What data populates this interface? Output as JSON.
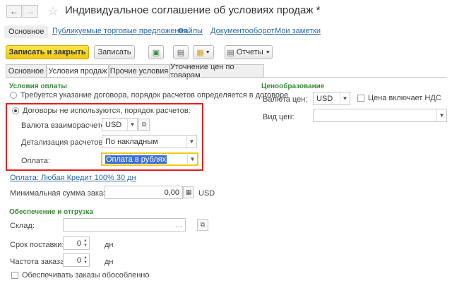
{
  "window": {
    "title": "Индивидуальное соглашение об условиях продаж *"
  },
  "nav": {
    "items": [
      "Основное",
      "Публикуемые торговые предложения",
      "Файлы",
      "Документооборот",
      "Мои заметки"
    ]
  },
  "toolbar": {
    "save_close_label": "Записать и закрыть",
    "save_label": "Записать",
    "reports_label": "Отчеты"
  },
  "tabs": [
    "Основное",
    "Условия продаж",
    "Прочие условия",
    "Уточнение цен по товарам"
  ],
  "payment_terms": {
    "section_title": "Условия оплаты",
    "option1_label": "Требуется указание договора, порядок расчетов определяется в договоре",
    "option2_label": "Договоры не используются, порядок расчетов:",
    "currency_label": "Валюта взаиморасчетов:",
    "currency_value": "USD",
    "detail_label": "Детализация расчетов:",
    "detail_value": "По накладным",
    "payment_label": "Оплата:",
    "payment_value": "Оплата в рублях",
    "payment_link": "Оплата: Любая Кредит 100% 30 дн",
    "min_order_label": "Минимальная сумма заказа:",
    "min_order_value": "0,00",
    "min_order_currency": "USD"
  },
  "pricing": {
    "section_title": "Ценообразование",
    "price_currency_label": "Валюта цен:",
    "price_currency_value": "USD",
    "vat_label": "Цена включает НДС",
    "price_type_label": "Вид цен:",
    "price_type_value": ""
  },
  "shipping": {
    "section_title": "Обеспечение и отгрузка",
    "warehouse_label": "Склад:",
    "warehouse_value": "",
    "delivery_label": "Срок поставки:",
    "delivery_value": "0",
    "delivery_unit": "дн",
    "frequency_label": "Частота заказа:",
    "frequency_value": "0",
    "frequency_unit": "дн",
    "separate_label": "Обеспечивать заказы обособленно"
  },
  "colors": {
    "accent_yellow": "#f5d320",
    "section_green": "#3a8a3a",
    "highlight_red": "#e02020",
    "link_blue": "#2c6aa6",
    "selection_blue": "#3a6fd8"
  }
}
